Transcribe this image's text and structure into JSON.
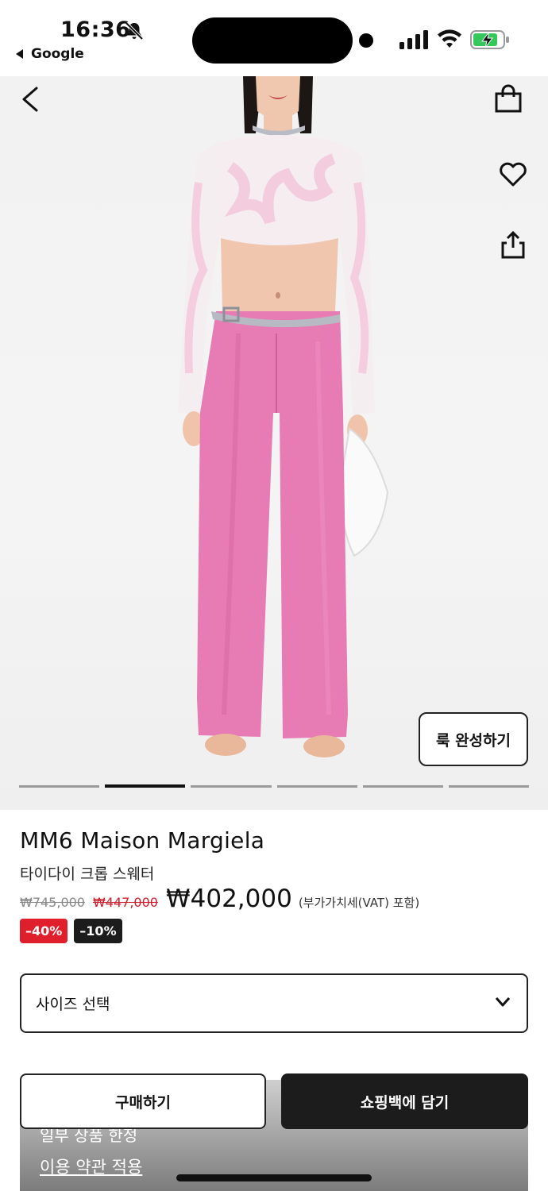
{
  "status": {
    "time": "16:36",
    "back_app": "Google"
  },
  "product": {
    "brand": "MM6 Maison Margiela",
    "name": "타이다이 크롭 스웨터",
    "price_original": "₩745,000",
    "price_previous": "₩447,000",
    "price_final": "₩402,000",
    "vat_note": "(부가가치세(VAT) 포함)",
    "discount_badge_1": "–40%",
    "discount_badge_2": "–10%"
  },
  "hero": {
    "look_button": "룩 완성하기",
    "slide_count": 6,
    "active_slide": 2
  },
  "size_select": {
    "placeholder": "사이즈 선택"
  },
  "actions": {
    "buy_label": "구매하기",
    "cart_label": "쇼핑백에 담기"
  },
  "footer": {
    "notice_partial": "일부 상품 한정",
    "terms_link": "이용 약관 적용"
  },
  "colors": {
    "accent_red": "#e01f2d",
    "dark": "#1c1c1c",
    "pants_pink": "#e77bb3"
  }
}
